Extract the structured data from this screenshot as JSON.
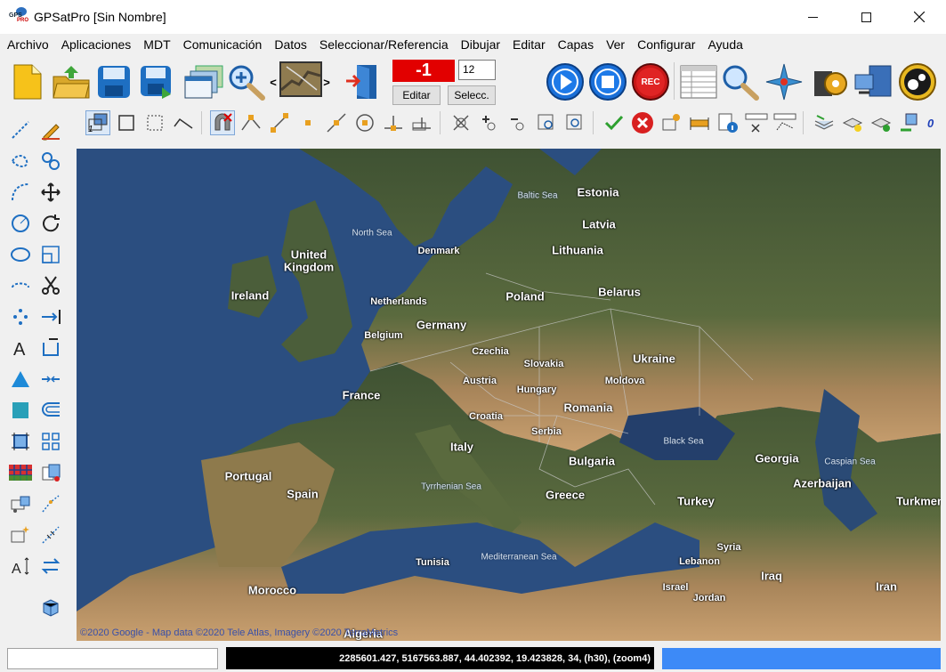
{
  "window": {
    "title": "GPSatPro [Sin Nombre]",
    "app_icon_text_top": "GPS",
    "app_icon_text_bottom": "PRO"
  },
  "menu": [
    "Archivo",
    "Aplicaciones",
    "MDT",
    "Comunicación",
    "Datos",
    "Seleccionar/Referencia",
    "Dibujar",
    "Editar",
    "Capas",
    "Ver",
    "Configurar",
    "Ayuda"
  ],
  "toolbar": {
    "nav_prev": "<",
    "nav_next": ">",
    "counter_value": "-1",
    "number_input": "12",
    "editar_label": "Editar",
    "selecc_label": "Selecc.",
    "rec_label": "REC"
  },
  "edit_toolbar": {
    "layer_index": "1",
    "right_value": "0"
  },
  "map": {
    "labels": [
      {
        "text": "Estonia",
        "cls": "big"
      },
      {
        "text": "Latvia",
        "cls": "big"
      },
      {
        "text": "Lithuania",
        "cls": "big"
      },
      {
        "text": "Belarus",
        "cls": "big"
      },
      {
        "text": "Poland",
        "cls": "big"
      },
      {
        "text": "Denmark",
        "cls": "med"
      },
      {
        "text": "United",
        "cls": "big"
      },
      {
        "text": "Kingdom",
        "cls": "big"
      },
      {
        "text": "Ireland",
        "cls": "big"
      },
      {
        "text": "Netherlands",
        "cls": "med"
      },
      {
        "text": "Germany",
        "cls": "big"
      },
      {
        "text": "Belgium",
        "cls": "med"
      },
      {
        "text": "Czechia",
        "cls": "med"
      },
      {
        "text": "Slovakia",
        "cls": "med"
      },
      {
        "text": "Ukraine",
        "cls": "big"
      },
      {
        "text": "Austria",
        "cls": "med"
      },
      {
        "text": "Hungary",
        "cls": "med"
      },
      {
        "text": "Moldova",
        "cls": "med"
      },
      {
        "text": "France",
        "cls": "big"
      },
      {
        "text": "Romania",
        "cls": "big"
      },
      {
        "text": "Croatia",
        "cls": "med"
      },
      {
        "text": "Serbia",
        "cls": "med"
      },
      {
        "text": "Italy",
        "cls": "big"
      },
      {
        "text": "Bulgaria",
        "cls": "big"
      },
      {
        "text": "Portugal",
        "cls": "big"
      },
      {
        "text": "Spain",
        "cls": "big"
      },
      {
        "text": "Greece",
        "cls": "big"
      },
      {
        "text": "Turkey",
        "cls": "big"
      },
      {
        "text": "Georgia",
        "cls": "big"
      },
      {
        "text": "Azerbaijan",
        "cls": "big"
      },
      {
        "text": "Turkmen",
        "cls": "big"
      },
      {
        "text": "Syria",
        "cls": "med"
      },
      {
        "text": "Lebanon",
        "cls": "med"
      },
      {
        "text": "Iraq",
        "cls": "big"
      },
      {
        "text": "Iran",
        "cls": "big"
      },
      {
        "text": "Israel",
        "cls": "med"
      },
      {
        "text": "Jordan",
        "cls": "med"
      },
      {
        "text": "Tunisia",
        "cls": "med"
      },
      {
        "text": "Morocco",
        "cls": "big"
      },
      {
        "text": "Algeria",
        "cls": "big"
      },
      {
        "text": "Baltic Sea",
        "cls": "sea"
      },
      {
        "text": "North Sea",
        "cls": "sea"
      },
      {
        "text": "Black Sea",
        "cls": "sea"
      },
      {
        "text": "Caspian Sea",
        "cls": "sea"
      },
      {
        "text": "Tyrrhenian Sea",
        "cls": "sea"
      },
      {
        "text": "Mediterranean Sea",
        "cls": "sea"
      }
    ],
    "credit": "©2020 Google - Map data ©2020 Tele Atlas, Imagery ©2020 TerraMetrics"
  },
  "status": {
    "left_text": "",
    "coords": "2285601.427, 5167563.887, 44.402392, 19.423828, 34, (h30), (zoom4)"
  },
  "colors": {
    "counter_bg": "#e20000",
    "coords_bg": "#000000",
    "progress": "#3d8af7",
    "sea": "#2a4d7e",
    "land": "#4a5e3a"
  }
}
